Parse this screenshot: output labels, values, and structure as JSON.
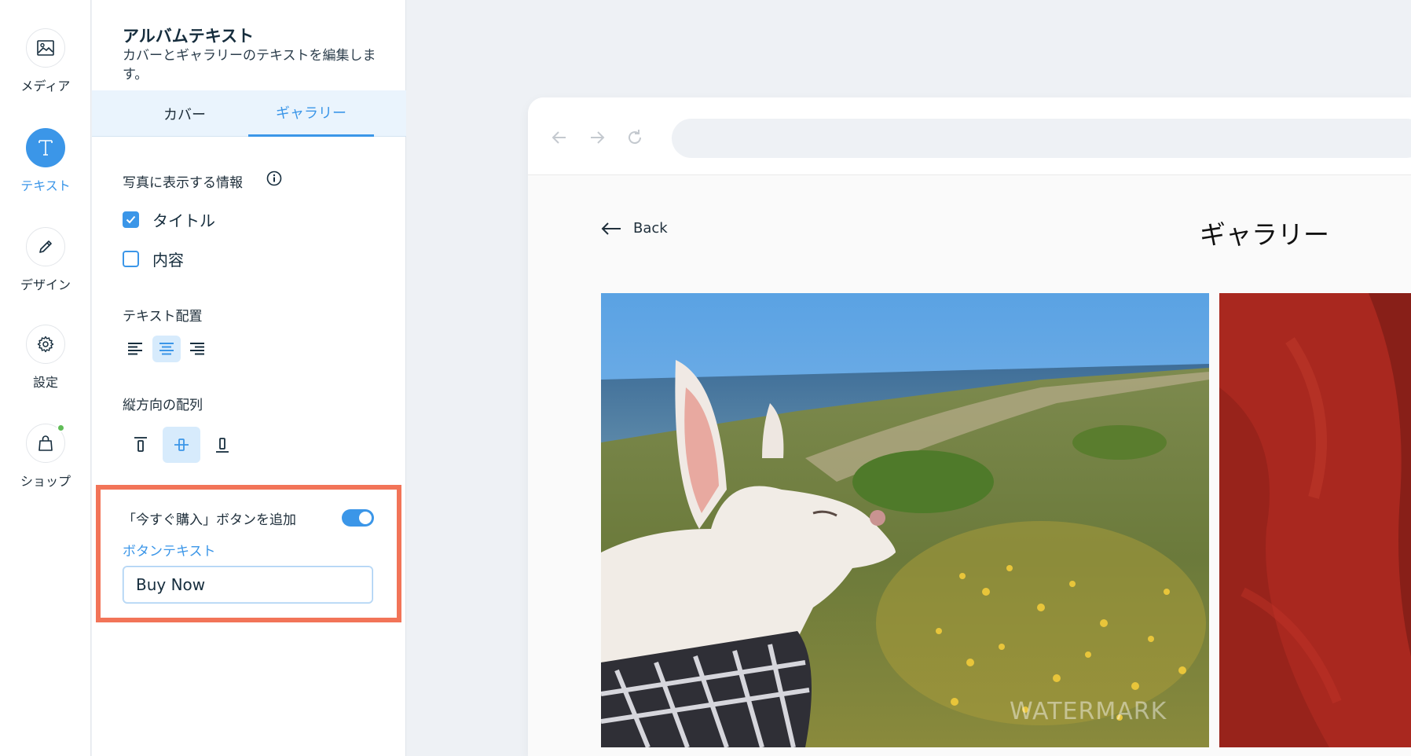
{
  "rail": {
    "items": [
      {
        "label": "メディア",
        "icon": "image-icon"
      },
      {
        "label": "テキスト",
        "icon": "text-icon",
        "active": true
      },
      {
        "label": "デザイン",
        "icon": "pen-icon"
      },
      {
        "label": "設定",
        "icon": "gear-icon"
      },
      {
        "label": "ショップ",
        "icon": "bag-icon",
        "badge": "green-dot"
      }
    ]
  },
  "panel": {
    "title": "アルバムテキスト",
    "subtitle": "カバーとギャラリーのテキストを編集します。",
    "tabs": [
      {
        "label": "カバー"
      },
      {
        "label": "ギャラリー",
        "active": true
      }
    ],
    "photo_info": {
      "label": "写真に表示する情報",
      "options": [
        {
          "label": "タイトル",
          "checked": true
        },
        {
          "label": "内容",
          "checked": false
        }
      ]
    },
    "text_align": {
      "label": "テキスト配置",
      "selected": "center"
    },
    "vertical_align": {
      "label": "縦方向の配列",
      "selected": "middle"
    },
    "buy_now": {
      "toggle_label": "「今すぐ購入」ボタンを追加",
      "enabled": true,
      "button_text_label": "ボタンテキスト",
      "button_text_value": "Buy Now"
    }
  },
  "preview": {
    "back_label": "Back",
    "page_title": "ギャラリー",
    "watermark": "WATERMARK"
  },
  "colors": {
    "accent": "#3b96e8",
    "highlight": "#f27458",
    "badge": "#60bc57"
  }
}
